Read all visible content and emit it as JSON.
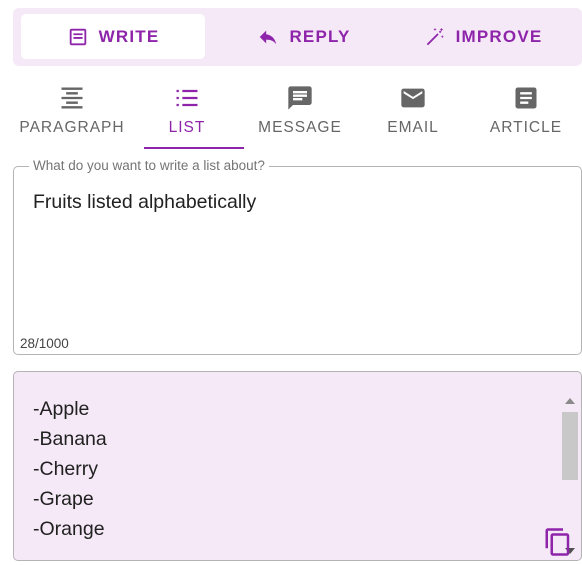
{
  "modes": {
    "write_label": "WRITE",
    "reply_label": "REPLY",
    "improve_label": "IMPROVE",
    "selected": "WRITE"
  },
  "tabs": {
    "paragraph_label": "PARAGRAPH",
    "list_label": "LIST",
    "message_label": "MESSAGE",
    "email_label": "EMAIL",
    "article_label": "ARTICLE",
    "selected": "LIST"
  },
  "prompt": {
    "legend": "What do you want to write a list about?",
    "value": "Fruits listed alphabetically",
    "char_count": "28/1000"
  },
  "output": {
    "items": [
      "-Apple",
      "-Banana",
      "-Cherry",
      "-Grape",
      "-Orange"
    ]
  },
  "colors": {
    "accent": "#8e24aa",
    "panel_background": "#f5e9f7",
    "inactive_tab": "#666666"
  },
  "icons": {
    "write": "notes-icon",
    "reply": "reply-arrow-icon",
    "improve": "magic-wand-icon",
    "paragraph": "align-center-icon",
    "list": "list-icon",
    "message": "chat-bubble-icon",
    "email": "envelope-icon",
    "article": "article-icon",
    "copy": "copy-icon"
  }
}
